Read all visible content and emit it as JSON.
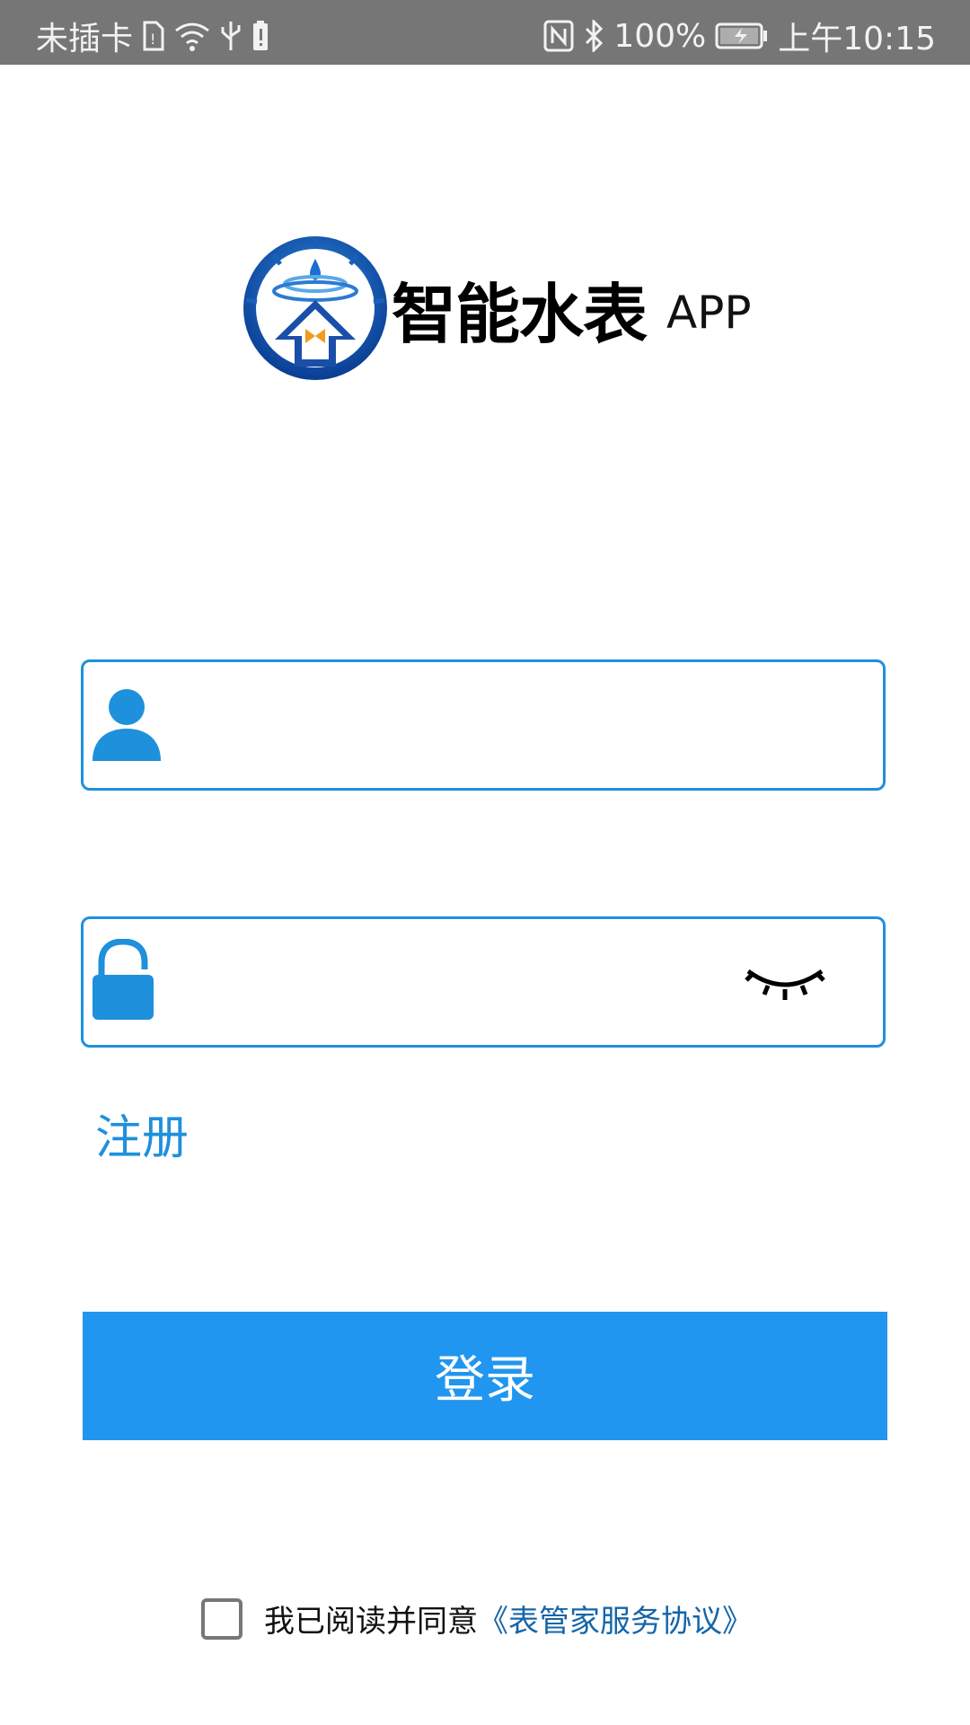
{
  "status_bar": {
    "carrier": "未插卡",
    "battery_percent": "100%",
    "time": "上午10:15"
  },
  "logo": {
    "title": "智能水表",
    "suffix": "APP"
  },
  "form": {
    "username_value": "",
    "password_value": "",
    "register_label": "注册",
    "login_label": "登录"
  },
  "agreement": {
    "text": "我已阅读并同意",
    "link": "《表管家服务协议》",
    "checked": false
  },
  "icons": {
    "username": "user-icon",
    "password": "lock-icon",
    "toggle_password": "eye-closed-icon"
  },
  "colors": {
    "accent": "#1e90dc",
    "button": "#2196f0",
    "link": "#1565a8",
    "status_bar": "#767676"
  }
}
